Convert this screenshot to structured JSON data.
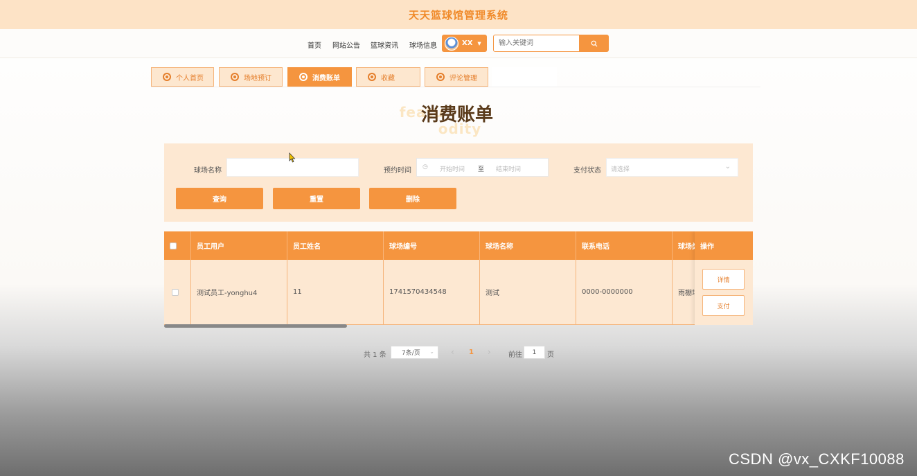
{
  "site": {
    "title": "天天篮球馆管理系统"
  },
  "nav": {
    "links": [
      "首页",
      "网站公告",
      "篮球资讯",
      "球场信息"
    ],
    "user_name": "XX",
    "search_placeholder": "输入关键词"
  },
  "tabs": [
    "个人首页",
    "场地预订",
    "消费账单",
    "收藏",
    "评论管理"
  ],
  "active_tab": "消费账单",
  "page": {
    "heading": "消费账单",
    "heading_bg": "featu",
    "heading_bg_2": "odity"
  },
  "filters": {
    "venue_name_label": "球场名称",
    "booking_time_label": "预约时间",
    "start_placeholder": "开始时间",
    "range_separator": "至",
    "end_placeholder": "结束时间",
    "pay_status_label": "支付状态",
    "pay_status_placeholder": "请选择",
    "buttons": {
      "query": "查询",
      "reset": "重置",
      "delete": "删除"
    }
  },
  "table": {
    "columns": [
      "员工用户",
      "员工姓名",
      "球场编号",
      "球场名称",
      "联系电话",
      "球场类"
    ],
    "ops_header": "操作",
    "rows": [
      {
        "staff_user": "测试员工-yonghu4",
        "staff_name": "11",
        "venue_no": "1741570434548",
        "venue_name": "测试",
        "phone": "0000-0000000",
        "venue_type": "雨棚场",
        "ops": [
          "详情",
          "支付"
        ]
      }
    ]
  },
  "pagination": {
    "total": "共 1 条",
    "page_size": "7条/页",
    "prev": "‹",
    "current": "1",
    "next": "›",
    "goto_label": "前往",
    "goto_value": "1",
    "page_unit": "页"
  },
  "watermark": "CSDN @vx_CXKF10088",
  "colors": {
    "accent": "#f5953f",
    "panel": "#fde8d2",
    "header_bg": "#fde3c6",
    "title": "#f08a2a"
  }
}
